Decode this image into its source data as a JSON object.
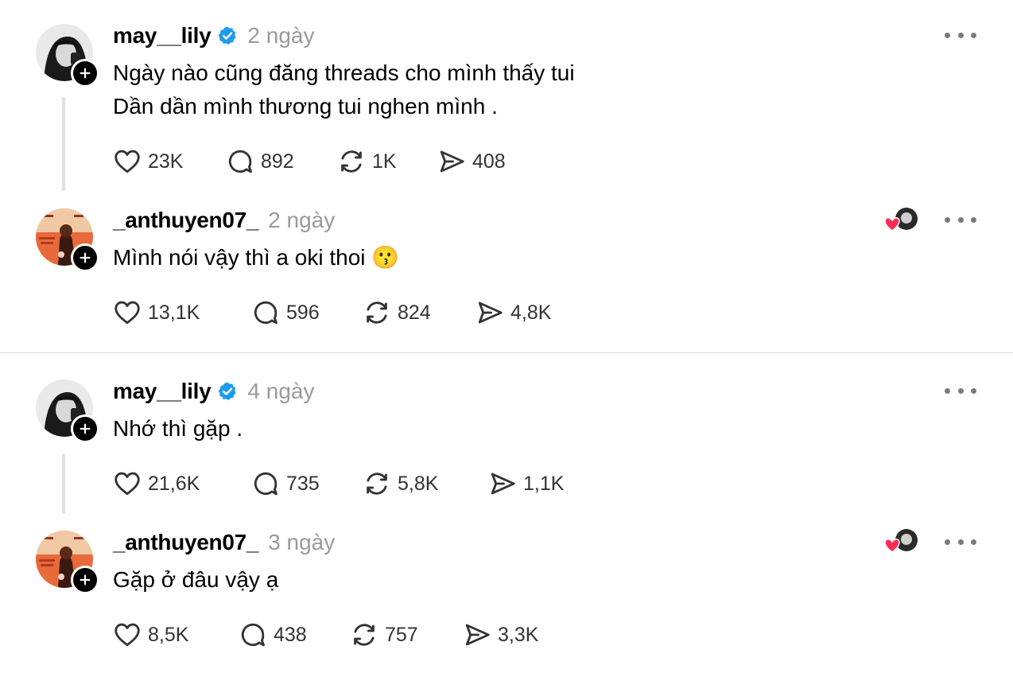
{
  "colors": {
    "verified_blue": "#1d9bf0",
    "heart_red": "#ff2d55",
    "muted_gray": "#9a9a9a"
  },
  "posts": [
    {
      "username": "may__lily",
      "verified": true,
      "time": "2 ngày",
      "text_lines": [
        "Ngày nào cũng đăng threads cho mình thấy tui",
        "Dần dần mình thương tui nghen mình ."
      ],
      "likes": "23K",
      "replies": "892",
      "reposts": "1K",
      "shares": "408",
      "icons": [
        "heart-icon",
        "comment-icon",
        "repost-icon",
        "share-icon",
        "more-options-icon"
      ]
    },
    {
      "username": "_anthuyen07_",
      "verified": false,
      "time": "2 ngày",
      "text_lines": [
        "Mình nói vậy thì a oki thoi 😗"
      ],
      "likes": "13,1K",
      "replies": "596",
      "reposts": "824",
      "shares": "4,8K",
      "liked_by_author": true
    },
    {
      "username": "may__lily",
      "verified": true,
      "time": "4 ngày",
      "text_lines": [
        "Nhớ thì gặp ."
      ],
      "likes": "21,6K",
      "replies": "735",
      "reposts": "5,8K",
      "shares": "1,1K"
    },
    {
      "username": "_anthuyen07_",
      "verified": false,
      "time": "3 ngày",
      "text_lines": [
        "Gặp ở đâu vậy ạ"
      ],
      "likes": "8,5K",
      "replies": "438",
      "reposts": "757",
      "shares": "3,3K",
      "liked_by_author": true
    }
  ]
}
